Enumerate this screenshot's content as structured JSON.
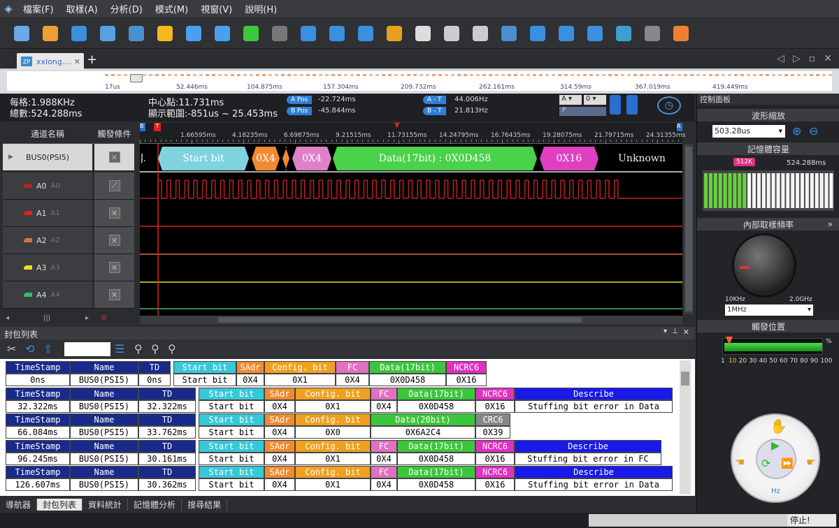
{
  "menu": [
    "檔案(F)",
    "取樣(A)",
    "分析(D)",
    "模式(M)",
    "視窗(V)",
    "說明(H)"
  ],
  "toolbar": [
    {
      "icon": "new-file-icon",
      "color": "#6aa8e8"
    },
    {
      "icon": "open-folder-icon",
      "color": "#f0a030"
    },
    {
      "icon": "save-icon",
      "color": "#3a8fe0"
    },
    {
      "icon": "print-icon",
      "color": "#5aa0e0"
    },
    {
      "icon": "save-settings-icon",
      "color": "#4a90d0"
    },
    {
      "icon": "star-icon",
      "color": "#f5b820"
    },
    {
      "icon": "wizard-icon",
      "color": "#4aa0f0"
    },
    {
      "icon": "tools-icon",
      "color": "#4aa0f0"
    },
    {
      "icon": "run-icon",
      "color": "#3cc83c"
    },
    {
      "icon": "stop-icon",
      "color": "#777"
    },
    {
      "icon": "add-marker-icon",
      "color": "#3a8fe0"
    },
    {
      "icon": "marker-icon",
      "color": "#3a8fe0"
    },
    {
      "icon": "marker-down-icon",
      "color": "#3a8fe0"
    },
    {
      "icon": "flashlight-icon",
      "color": "#e8a020"
    },
    {
      "icon": "pages-icon",
      "color": "#ddd"
    },
    {
      "icon": "handshake-icon",
      "color": "#ccc"
    },
    {
      "icon": "handshake2-icon",
      "color": "#ccc"
    },
    {
      "icon": "binary-icon",
      "color": "#4a90d0"
    },
    {
      "icon": "zoom-in-icon",
      "color": "#3a8fe0"
    },
    {
      "icon": "zoom-out-icon",
      "color": "#3a8fe0"
    },
    {
      "icon": "zoom-p-icon",
      "color": "#3a8fe0"
    },
    {
      "icon": "undo-zoom-icon",
      "color": "#3aa0d0"
    },
    {
      "icon": "probe-icon",
      "color": "#888"
    },
    {
      "icon": "lifebuoy-icon",
      "color": "#f08030"
    }
  ],
  "tab": {
    "label": "xxlong....",
    "badge": "ZP",
    "add": "+"
  },
  "overview": {
    "ticks": [
      "17us",
      "52.446ms",
      "104.875ms",
      "157.304ms",
      "209.732ms",
      "262.161ms",
      "314.59ms",
      "367.019ms",
      "419.449ms"
    ]
  },
  "info": {
    "per_div": "每格:1.988KHz",
    "total": "總數:524.288ms",
    "center": "中心點:11.731ms",
    "range": "顯示範圍:-851us ~ 25.453ms",
    "a_pos_label": "A Pos",
    "a_pos": "-22.724ms",
    "b_pos_label": "B Pos",
    "b_pos": "-45.844ms",
    "a_t_label": "A - T",
    "a_t": "44.006Hz",
    "b_t_label": "B - T",
    "b_t": "21.813Hz",
    "sel1": "A",
    "sel2": "0",
    "p_label": "P"
  },
  "channels": {
    "head_name": "通道名稱",
    "head_trig": "觸發條件",
    "bus": "BUS0(PSI5)",
    "items": [
      {
        "label": "A0",
        "sub": "A0",
        "color": "#c02020"
      },
      {
        "label": "A1",
        "sub": "A1",
        "color": "#e02020"
      },
      {
        "label": "A2",
        "sub": "A2",
        "color": "#e07040"
      },
      {
        "label": "A3",
        "sub": "A3",
        "color": "#e8e020"
      },
      {
        "label": "A4",
        "sub": "A4",
        "color": "#30c070"
      }
    ]
  },
  "ruler": {
    "ticks": [
      "1.66595ms",
      "4.18235ms",
      "6.69875ms",
      "9.21515ms",
      "11.73155ms",
      "14.24795ms",
      "16.76435ms",
      "19.28075ms",
      "21.79715ms",
      "24.31355ms"
    ]
  },
  "bus_segments": [
    {
      "text": "J.",
      "color": "#ffffff",
      "txt": "#ddd"
    },
    {
      "text": "Start bit",
      "color": "#7fd3dd",
      "txt": "#fff"
    },
    {
      "text": "0X4",
      "color": "#f08a30",
      "txt": "#fff"
    },
    {
      "text": "",
      "color": "#f08a30",
      "txt": "#fff"
    },
    {
      "text": "0X4",
      "color": "#e080c8",
      "txt": "#fff"
    },
    {
      "text": "Data(17bit) : 0X0D458",
      "color": "#4ad24a",
      "txt": "#fff"
    },
    {
      "text": "0X16",
      "color": "#e040c0",
      "txt": "#fff"
    },
    {
      "text": "Unknown",
      "color": "#000000",
      "txt": "#eee"
    }
  ],
  "panel": {
    "title": "控制面板",
    "wave_zoom": "波形縮放",
    "zoom_value": "503.28us",
    "memory": "記憶體容量",
    "mem_badge": "512K",
    "mem_total": "524.288ms",
    "sample_rate": "內部取樣頻率",
    "knob_min": "10KHz",
    "knob_max": "2.0GHz",
    "rate_value": "1MHz",
    "trigger_pos": "觸發位置",
    "trig_ticks": [
      "1",
      "10",
      "20",
      "30",
      "40",
      "50",
      "60",
      "70",
      "80",
      "90",
      "100"
    ],
    "pct": "%",
    "hz": "Hz"
  },
  "packets": {
    "title": "封包列表",
    "rows": [
      {
        "cols": [
          {
            "h": "TimeStamp",
            "v": "0ns",
            "c": "#1a2a8a"
          },
          {
            "h": "Name",
            "v": "BUS0(PSI5)",
            "c": "#1a2a8a"
          },
          {
            "h": "TD",
            "v": "0ns",
            "c": "#1a2a8a"
          },
          {
            "h": "Start bit",
            "v": "Start bit",
            "c": "#37c8d8"
          },
          {
            "h": "SAdr",
            "v": "0X4",
            "c": "#f08a30"
          },
          {
            "h": "Config. bit",
            "v": "0X1",
            "c": "#f0a020"
          },
          {
            "h": "FC",
            "v": "0X4",
            "c": "#e070c0"
          },
          {
            "h": "Data(17bit)",
            "v": "0X0D458",
            "c": "#3cc63c"
          },
          {
            "h": "NCRC6",
            "v": "0X16",
            "c": "#e030c0"
          }
        ]
      },
      {
        "cols": [
          {
            "h": "TimeStamp",
            "v": "32.322ms",
            "c": "#1a2a8a"
          },
          {
            "h": "Name",
            "v": "BUS0(PSI5)",
            "c": "#1a2a8a"
          },
          {
            "h": "TD",
            "v": "32.322ms",
            "c": "#1a2a8a"
          },
          {
            "h": "Start bit",
            "v": "Start bit",
            "c": "#37c8d8"
          },
          {
            "h": "SAdr",
            "v": "0X4",
            "c": "#f08a30"
          },
          {
            "h": "Config. bit",
            "v": "0X1",
            "c": "#f0a020"
          },
          {
            "h": "FC",
            "v": "0X4",
            "c": "#e070c0"
          },
          {
            "h": "Data(17bit)",
            "v": "0X0D458",
            "c": "#3cc63c"
          },
          {
            "h": "NCRC6",
            "v": "0X16",
            "c": "#e030c0"
          },
          {
            "h": "Describe",
            "v": "Stuffing bit error in Data",
            "c": "#1a1ae8"
          }
        ]
      },
      {
        "cols": [
          {
            "h": "TimeStamp",
            "v": "66.084ms",
            "c": "#1a2a8a"
          },
          {
            "h": "Name",
            "v": "BUS0(PSI5)",
            "c": "#1a2a8a"
          },
          {
            "h": "TD",
            "v": "33.762ms",
            "c": "#1a2a8a"
          },
          {
            "h": "Start bit",
            "v": "Start bit",
            "c": "#37c8d8"
          },
          {
            "h": "SAdr",
            "v": "0X4",
            "c": "#f08a30"
          },
          {
            "h": "Config. bit",
            "v": "0X0",
            "c": "#f0a020"
          },
          {
            "h": "Data(20bit)",
            "v": "0X6A2C4",
            "c": "#3cc63c"
          },
          {
            "h": "CRC6",
            "v": "0X39",
            "c": "#888888"
          }
        ]
      },
      {
        "cols": [
          {
            "h": "TimeStamp",
            "v": "96.245ms",
            "c": "#1a2a8a"
          },
          {
            "h": "Name",
            "v": "BUS0(PSI5)",
            "c": "#1a2a8a"
          },
          {
            "h": "TD",
            "v": "30.161ms",
            "c": "#1a2a8a"
          },
          {
            "h": "Start bit",
            "v": "Start bit",
            "c": "#37c8d8"
          },
          {
            "h": "SAdr",
            "v": "0X4",
            "c": "#f08a30"
          },
          {
            "h": "Config. bit",
            "v": "0X1",
            "c": "#f0a020"
          },
          {
            "h": "FC",
            "v": "0X4",
            "c": "#e070c0"
          },
          {
            "h": "Data(17bit)",
            "v": "0X0D458",
            "c": "#3cc63c"
          },
          {
            "h": "NCRC6",
            "v": "0X16",
            "c": "#e030c0"
          },
          {
            "h": "Describe",
            "v": "Stuffing bit error in FC",
            "c": "#1a1ae8"
          }
        ]
      },
      {
        "cols": [
          {
            "h": "TimeStamp",
            "v": "126.607ms",
            "c": "#1a2a8a"
          },
          {
            "h": "Name",
            "v": "BUS0(PSI5)",
            "c": "#1a2a8a"
          },
          {
            "h": "TD",
            "v": "30.362ms",
            "c": "#1a2a8a"
          },
          {
            "h": "Start bit",
            "v": "Start bit",
            "c": "#37c8d8"
          },
          {
            "h": "SAdr",
            "v": "0X4",
            "c": "#f08a30"
          },
          {
            "h": "Config. bit",
            "v": "0X1",
            "c": "#f0a020"
          },
          {
            "h": "FC",
            "v": "0X4",
            "c": "#e070c0"
          },
          {
            "h": "Data(17bit)",
            "v": "0X0D458",
            "c": "#3cc63c"
          },
          {
            "h": "NCRC6",
            "v": "0X16",
            "c": "#e030c0"
          },
          {
            "h": "Describe",
            "v": "Stuffing bit error in Data",
            "c": "#1a1ae8"
          }
        ]
      }
    ]
  },
  "bottom_tabs": [
    "導航器",
    "封包列表",
    "資料統計",
    "記憶體分析",
    "搜尋結果"
  ],
  "status": "停止!"
}
